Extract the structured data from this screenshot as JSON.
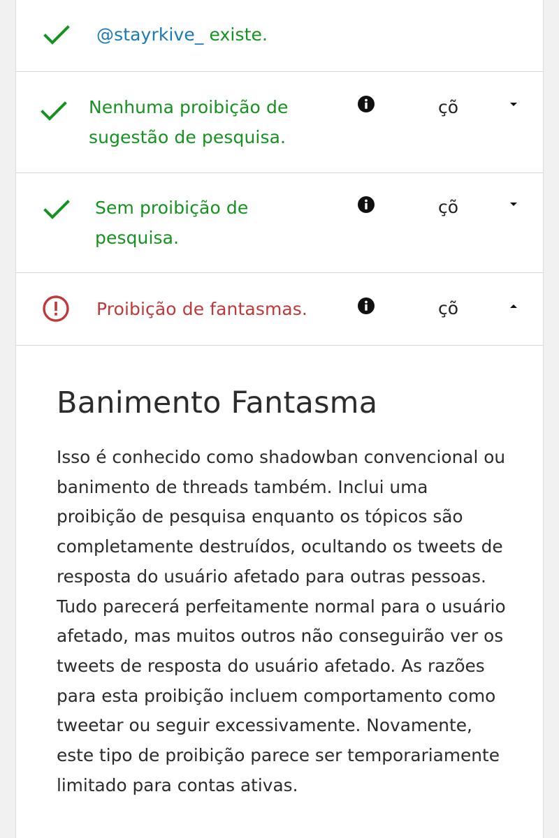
{
  "checks": [
    {
      "status": "ok",
      "handle": "@stayrkive_",
      "text": " existe."
    },
    {
      "status": "ok",
      "line1": "Nenhuma proibição de",
      "line2": "sugestão de pesquisa.",
      "aux": "çõ",
      "expanded": false
    },
    {
      "status": "ok",
      "line1": "Sem proibição de",
      "line2": "pesquisa.",
      "aux": "çõ",
      "expanded": false
    },
    {
      "status": "bad",
      "text": "Proibição de fantasmas.",
      "aux": "çõ",
      "expanded": true
    }
  ],
  "detail": {
    "title": "Banimento Fantasma",
    "body": "Isso é conhecido como shadowban convencional ou banimento de threads também. Inclui uma proibição de pesquisa enquanto os tópicos são completamente destruídos, ocultando os tweets de resposta do usuário afetado para outras pessoas. Tudo parecerá perfeitamente normal para o usuário afetado, mas muitos outros não conseguirão ver os tweets de resposta do usuário afetado. As razões para esta proibição incluem comportamento como tweetar ou seguir excessivamente. Novamente, este tipo de proibição parece ser temporariamente limitado para contas ativas."
  },
  "colors": {
    "ok": "#15921f",
    "bad": "#c0393a",
    "handle": "#1a7ab8"
  },
  "icons": {
    "ok": "checkmark-icon",
    "bad": "exclamation-circle-icon",
    "info": "info-icon",
    "collapsed": "caret-down-icon",
    "expanded": "caret-up-icon"
  }
}
